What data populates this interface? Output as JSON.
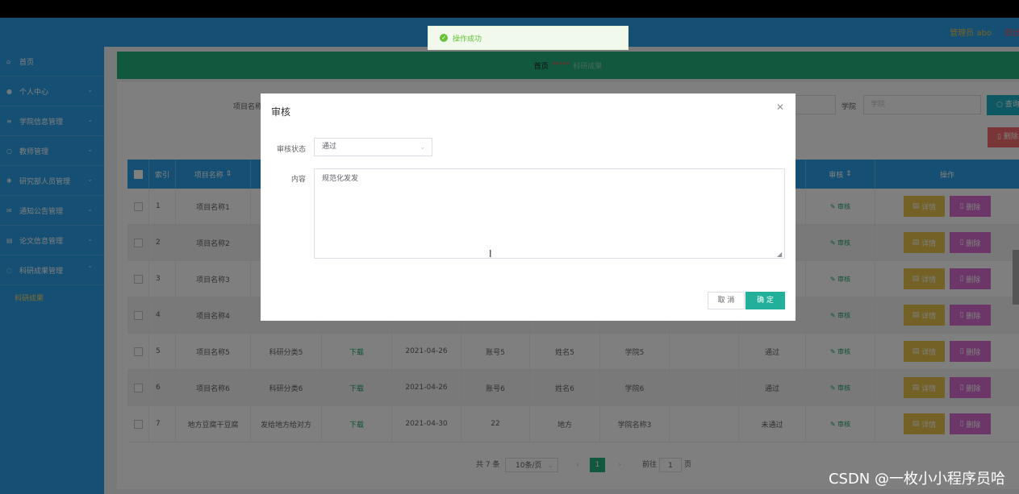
{
  "header": {
    "user": "管理员 abo",
    "logout": "退出登录"
  },
  "sidebar": {
    "items": [
      {
        "label": "首页",
        "icon": "home-icon",
        "chevron": false
      },
      {
        "label": "个人中心",
        "icon": "user-icon",
        "chevron": true
      },
      {
        "label": "学院信息管理",
        "icon": "list-icon",
        "chevron": true
      },
      {
        "label": "教师管理",
        "icon": "circle-icon",
        "chevron": true
      },
      {
        "label": "研究部人员管理",
        "icon": "gear-icon",
        "chevron": true
      },
      {
        "label": "通知公告管理",
        "icon": "mail-icon",
        "chevron": true
      },
      {
        "label": "论文信息管理",
        "icon": "doc-icon",
        "chevron": true
      },
      {
        "label": "科研成果管理",
        "icon": "circle-icon",
        "chevron": true
      }
    ],
    "sub_item": "科研成果"
  },
  "breadcrumb": {
    "home": "首页",
    "sep": "*****",
    "current": "科研成果"
  },
  "search": {
    "project_label": "项目名称",
    "college_label": "学院",
    "college_placeholder": "学院",
    "query_label": "查询",
    "batch_delete_label": "删除"
  },
  "table": {
    "headers": {
      "index": "索引",
      "name": "项目名称",
      "audit": "审核",
      "operation": "操作"
    },
    "detail_label": "详情",
    "delete_label": "删除",
    "audit_link": "审核",
    "download": "下载",
    "rows": [
      {
        "index": "1",
        "name": "项目名称1",
        "category": "",
        "download": "",
        "date": "",
        "account": "",
        "username": "",
        "college": "",
        "blank": "",
        "status": ""
      },
      {
        "index": "2",
        "name": "项目名称2",
        "category": "",
        "download": "",
        "date": "",
        "account": "",
        "username": "",
        "college": "",
        "blank": "",
        "status": ""
      },
      {
        "index": "3",
        "name": "项目名称3",
        "category": "",
        "download": "",
        "date": "",
        "account": "",
        "username": "",
        "college": "",
        "blank": "",
        "status": ""
      },
      {
        "index": "4",
        "name": "项目名称4",
        "category": "",
        "download": "",
        "date": "",
        "account": "",
        "username": "",
        "college": "",
        "blank": "",
        "status": ""
      },
      {
        "index": "5",
        "name": "项目名称5",
        "category": "科研分类5",
        "download": "下载",
        "date": "2021-04-26",
        "account": "账号5",
        "username": "姓名5",
        "college": "学院5",
        "blank": "",
        "status": "通过"
      },
      {
        "index": "6",
        "name": "项目名称6",
        "category": "科研分类6",
        "download": "下载",
        "date": "2021-04-26",
        "account": "账号6",
        "username": "姓名6",
        "college": "学院6",
        "blank": "",
        "status": "通过"
      },
      {
        "index": "7",
        "name": "地方豆腐干豆腐",
        "category": "发给地方给对方",
        "download": "下载",
        "date": "2021-04-30",
        "account": "22",
        "username": "地方",
        "college": "学院名称3",
        "blank": "",
        "status": "未通过"
      }
    ]
  },
  "pagination": {
    "total": "共 7 条",
    "page_size": "10条/页",
    "current": "1",
    "goto_label": "前往",
    "goto_value": "1",
    "page_suffix": "页"
  },
  "dialog": {
    "title": "审核",
    "status_label": "审核状态",
    "status_value": "通过",
    "content_label": "内容",
    "content_value": "规范化发发",
    "cancel_label": "取 消",
    "ok_label": "确 定"
  },
  "toast": {
    "message": "操作成功"
  },
  "watermark": "CSDN @一枚小小程序员哈"
}
